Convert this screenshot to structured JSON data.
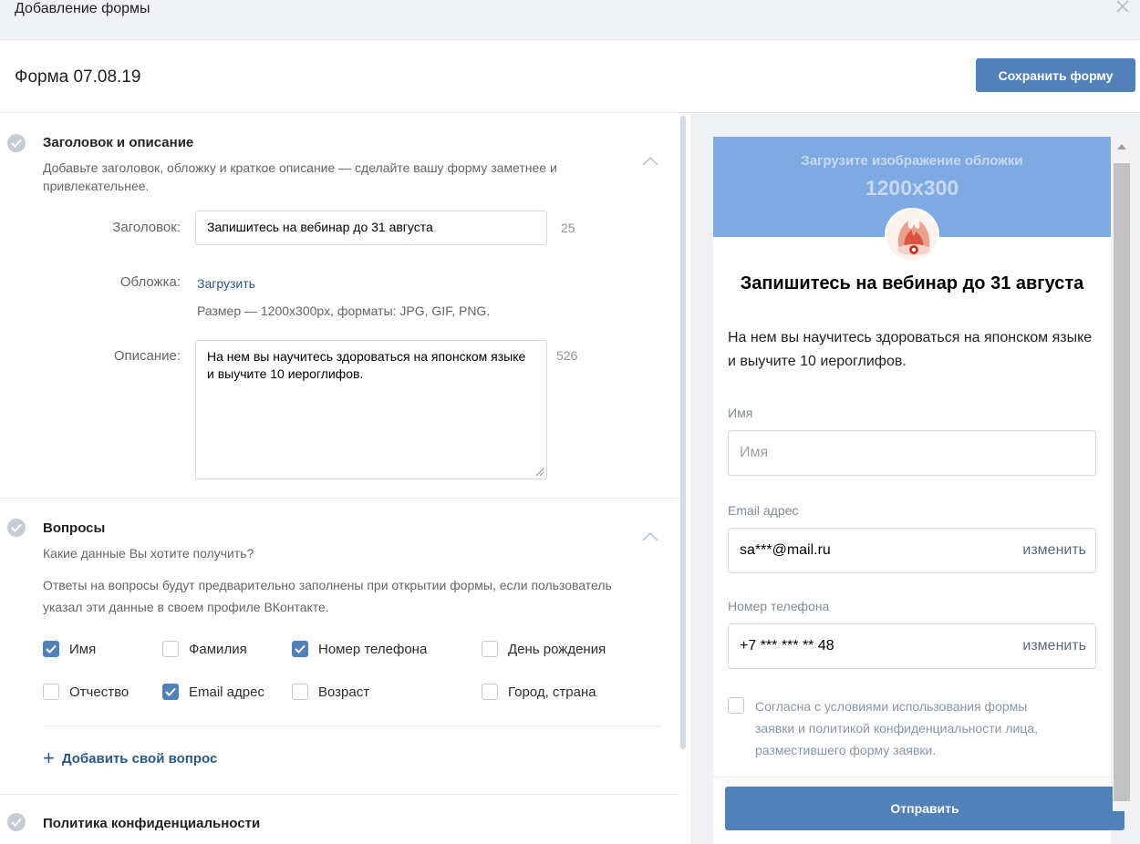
{
  "window": {
    "title": "Добавление формы"
  },
  "header": {
    "form_name": "Форма 07.08.19",
    "save_label": "Сохранить форму"
  },
  "sections": {
    "title_desc": {
      "title": "Заголовок и описание",
      "description": "Добавьте заголовок, обложку и краткое описание — сделайте вашу форму заметнее и привлекательнее.",
      "title_label": "Заголовок:",
      "title_value": "Запишитесь на вебинар до 31 августа",
      "title_counter": "25",
      "cover_label": "Обложка:",
      "cover_link": "Загрузить",
      "cover_hint": "Размер — 1200x300px, форматы: JPG, GIF, PNG.",
      "desc_label": "Описание:",
      "desc_value": "На нем вы научитесь здороваться на японском языке и выучите 10 иероглифов.",
      "desc_counter": "526"
    },
    "questions": {
      "title": "Вопросы",
      "subtitle": "Какие данные Вы хотите получить?",
      "note": "Ответы на вопросы будут предварительно заполнены при открытии формы, если пользователь указал эти данные в своем профиле ВКонтакте.",
      "options": [
        {
          "label": "Имя",
          "checked": true
        },
        {
          "label": "Фамилия",
          "checked": false
        },
        {
          "label": "Номер телефона",
          "checked": true
        },
        {
          "label": "День рождения",
          "checked": false
        },
        {
          "label": "Отчество",
          "checked": false
        },
        {
          "label": "Email адрес",
          "checked": true
        },
        {
          "label": "Возраст",
          "checked": false
        },
        {
          "label": "Город, страна",
          "checked": false
        }
      ],
      "add_label": "Добавить свой вопрос"
    },
    "privacy": {
      "title": "Политика конфиденциальности"
    }
  },
  "preview": {
    "cover_hint": "Загрузите изображение обложки",
    "cover_size": "1200x300",
    "title": "Запишитесь на вебинар до 31 августа",
    "description": "На нем вы научитесь здороваться на японском языке и выучите 10 иероглифов.",
    "fields": [
      {
        "label": "Имя",
        "placeholder": "Имя",
        "value": "",
        "action": ""
      },
      {
        "label": "Email адрес",
        "placeholder": "",
        "value": "sa***@mail.ru",
        "action": "изменить"
      },
      {
        "label": "Номер телефона",
        "placeholder": "",
        "value": "+7 *** *** ** 48",
        "action": "изменить"
      }
    ],
    "agreement": "Согласна с условиями использования формы заявки и политикой конфиденциальности лица, разместившего форму заявки.",
    "agreement_checked": false,
    "submit_label": "Отправить"
  },
  "colors": {
    "accent": "#5181b8",
    "link": "#2a5885",
    "cover": "#7fa9e1"
  }
}
